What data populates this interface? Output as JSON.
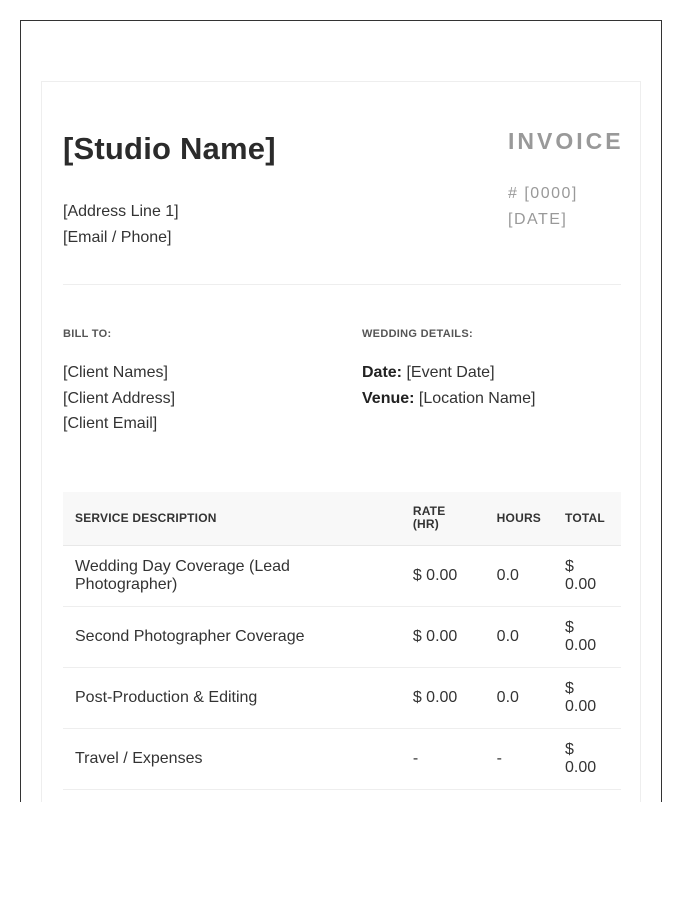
{
  "studio": {
    "name": "[Studio Name]",
    "address_line": "[Address Line 1]",
    "contact": "[Email / Phone]"
  },
  "invoice": {
    "title": "INVOICE",
    "number": "# [0000]",
    "date": "[DATE]"
  },
  "bill_to": {
    "label": "BILL TO:",
    "names": "[Client Names]",
    "address": "[Client Address]",
    "email": "[Client Email]"
  },
  "wedding": {
    "label": "WEDDING DETAILS:",
    "date_label": "Date:",
    "date_value": "[Event Date]",
    "venue_label": "Venue:",
    "venue_value": "[Location Name]"
  },
  "table": {
    "headers": {
      "description": "SERVICE DESCRIPTION",
      "rate": "RATE (HR)",
      "hours": "HOURS",
      "total": "TOTAL"
    },
    "rows": [
      {
        "description": "Wedding Day Coverage (Lead Photographer)",
        "rate": "$ 0.00",
        "hours": "0.0",
        "total_symbol": "$",
        "total_amount": "0.00"
      },
      {
        "description": "Second Photographer Coverage",
        "rate": "$ 0.00",
        "hours": "0.0",
        "total_symbol": "$",
        "total_amount": "0.00"
      },
      {
        "description": "Post-Production & Editing",
        "rate": "$ 0.00",
        "hours": "0.0",
        "total_symbol": "$",
        "total_amount": "0.00"
      },
      {
        "description": "Travel / Expenses",
        "rate": "-",
        "hours": "-",
        "total_symbol": "$",
        "total_amount": "0.00"
      }
    ]
  }
}
